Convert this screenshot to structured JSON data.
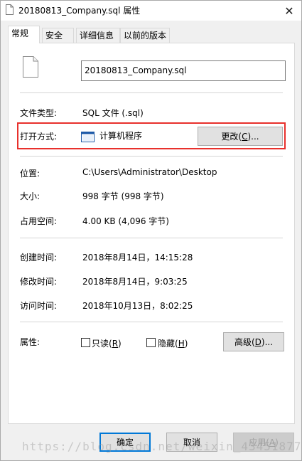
{
  "window": {
    "title": "20180813_Company.sql 属性",
    "close_glyph": "✕"
  },
  "tabs": [
    {
      "label": "常规",
      "active": true
    },
    {
      "label": "安全",
      "active": false
    },
    {
      "label": "详细信息",
      "active": false
    },
    {
      "label": "以前的版本",
      "active": false
    }
  ],
  "general": {
    "file_name": "20180813_Company.sql",
    "type_label": "文件类型:",
    "type_value": "SQL 文件 (.sql)",
    "open_with_label": "打开方式:",
    "open_with_value": "计算机程序",
    "change_button": {
      "text": "更改(",
      "key": "C",
      "suffix": ")..."
    },
    "location_label": "位置:",
    "location_value": "C:\\Users\\Administrator\\Desktop",
    "size_label": "大小:",
    "size_value": "998 字节 (998 字节)",
    "disk_label": "占用空间:",
    "disk_value": "4.00 KB (4,096 字节)",
    "created_label": "创建时间:",
    "created_value": "2018年8月14日，14:15:28",
    "modified_label": "修改时间:",
    "modified_value": "2018年8月14日，9:03:25",
    "accessed_label": "访问时间:",
    "accessed_value": "2018年10月13日，8:02:25",
    "attributes_label": "属性:",
    "readonly": {
      "text": "只读(",
      "key": "R",
      "suffix": ")",
      "checked": false
    },
    "hidden": {
      "text": "隐藏(",
      "key": "H",
      "suffix": ")",
      "checked": false
    },
    "advanced_button": {
      "text": "高级(",
      "key": "D",
      "suffix": ")..."
    }
  },
  "footer": {
    "ok": "确定",
    "cancel": "取消",
    "apply": {
      "text": "应用(",
      "key": "A",
      "suffix": ")"
    }
  },
  "watermark": "https://blog.csdn.net/weixin_43451877",
  "colors": {
    "highlight_border": "#e8302c",
    "focus_border": "#0078d7"
  }
}
